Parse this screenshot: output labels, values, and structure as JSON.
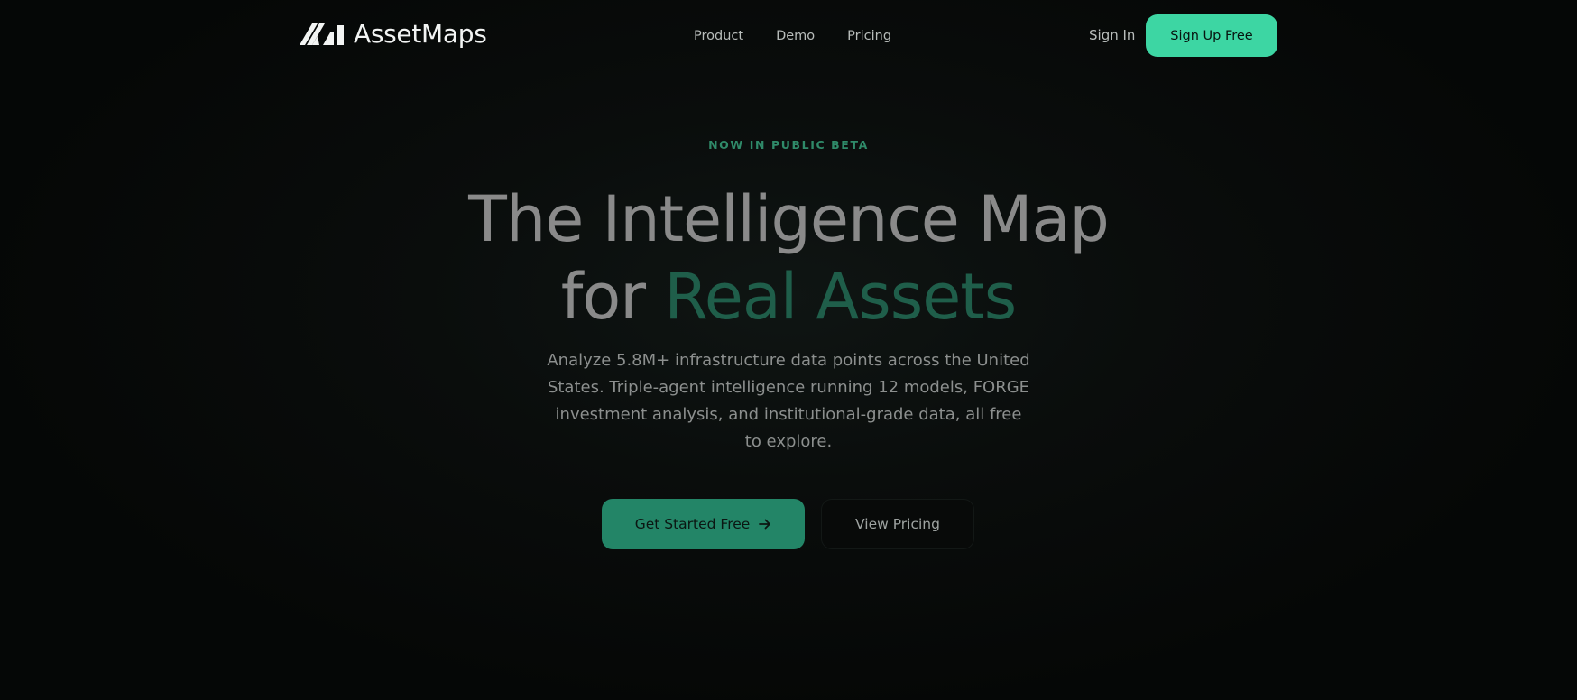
{
  "brand": {
    "name": "AssetMaps",
    "logo_icon": "assetmaps-logo-mark"
  },
  "nav": {
    "links": [
      {
        "label": "Product"
      },
      {
        "label": "Demo"
      },
      {
        "label": "Pricing"
      }
    ],
    "sign_in": "Sign In",
    "sign_up": "Sign Up Free"
  },
  "hero": {
    "eyebrow": "NOW IN PUBLIC BETA",
    "title_line1": "The Intelligence Map",
    "title_line2_prefix": "for",
    "title_line2_accent": "Real Assets",
    "subtitle": "Analyze 5.8M+ infrastructure data points across the United States. Triple-agent intelligence running 12 models, FORGE investment analysis, and institutional-grade data, all free to explore.",
    "primary_cta": "Get Started Free",
    "primary_cta_icon": "arrow-right-icon",
    "secondary_cta": "View Pricing"
  },
  "colors": {
    "background": "#050706",
    "accent": "#3dd6a3",
    "accent_dark": "#238567",
    "headline_accent": "#1f5e4a",
    "eyebrow": "#2f8a69"
  }
}
